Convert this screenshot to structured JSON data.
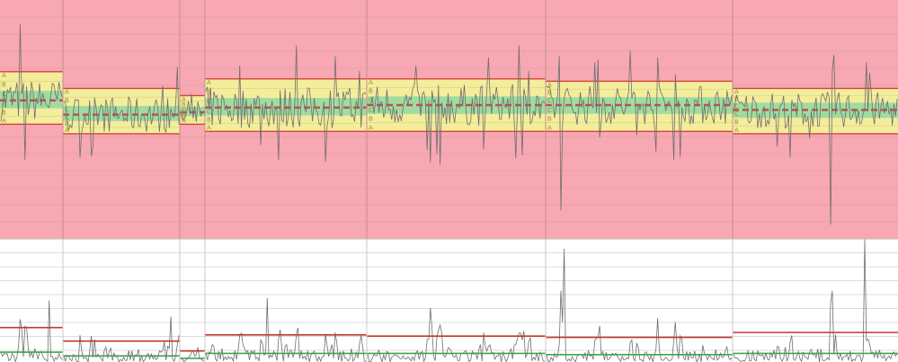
{
  "chart_data": [
    {
      "type": "control-chart",
      "name": "individuals",
      "zone_labels": [
        "A",
        "B",
        "C",
        "C",
        "B",
        "A"
      ],
      "y_range": [
        0,
        100
      ],
      "colors": {
        "out_of_control": "#f7a8b3",
        "zone_a": "#f3ed9c",
        "zone_b": "#f3ed9c",
        "zone_c": "#9fdca0",
        "center_line": "#c0504d",
        "limit_line": "#d9403a",
        "series": "#6e6e6e",
        "grid": "#e4a2ab"
      },
      "phases": [
        {
          "x": [
            0,
            70
          ],
          "ucl": 70,
          "lcl": 48,
          "center": 58,
          "a": 50,
          "c": 60,
          "spike_max": 90,
          "spike_min": 33
        },
        {
          "x": [
            70,
            200
          ],
          "ucl": 63,
          "lcl": 44,
          "center": 52,
          "a": 48,
          "c": 58,
          "spike_max": 72,
          "spike_min": 34
        },
        {
          "x": [
            200,
            228
          ],
          "ucl": 60,
          "lcl": 48,
          "center": 53,
          "a": 50,
          "c": 55,
          "spike_max": 61,
          "spike_min": 49
        },
        {
          "x": [
            228,
            408
          ],
          "ucl": 67,
          "lcl": 45,
          "center": 55,
          "a": 50,
          "c": 59,
          "spike_max": 81,
          "spike_min": 33
        },
        {
          "x": [
            408,
            607
          ],
          "ucl": 67,
          "lcl": 45,
          "center": 56,
          "a": 50,
          "c": 60,
          "spike_max": 81,
          "spike_min": 31
        },
        {
          "x": [
            607,
            815
          ],
          "ucl": 66,
          "lcl": 45,
          "center": 56,
          "a": 50,
          "c": 60,
          "spike_max": 74,
          "spike_min": 12
        },
        {
          "x": [
            815,
            999
          ],
          "ucl": 63,
          "lcl": 44,
          "center": 54,
          "a": 49,
          "c": 59,
          "spike_max": 77,
          "spike_min": 6
        }
      ]
    },
    {
      "type": "control-chart",
      "name": "moving-range",
      "y_range": [
        0,
        100
      ],
      "colors": {
        "ucl": "#c0392b",
        "center": "#3aa84a",
        "series": "#6e6e6e",
        "grid": "#dcdcdc"
      },
      "phases": [
        {
          "x": [
            0,
            70
          ],
          "ucl": 28,
          "center": 8,
          "spike_max": 50
        },
        {
          "x": [
            70,
            200
          ],
          "ucl": 17,
          "center": 5,
          "spike_max": 37
        },
        {
          "x": [
            200,
            228
          ],
          "ucl": 9,
          "center": 3,
          "spike_max": 12
        },
        {
          "x": [
            228,
            408
          ],
          "ucl": 22,
          "center": 7,
          "spike_max": 52
        },
        {
          "x": [
            408,
            607
          ],
          "ucl": 21,
          "center": 7,
          "spike_max": 44
        },
        {
          "x": [
            607,
            815
          ],
          "ucl": 20,
          "center": 6,
          "spike_max": 92
        },
        {
          "x": [
            815,
            999
          ],
          "ucl": 24,
          "center": 7,
          "spike_max": 108
        }
      ]
    }
  ]
}
